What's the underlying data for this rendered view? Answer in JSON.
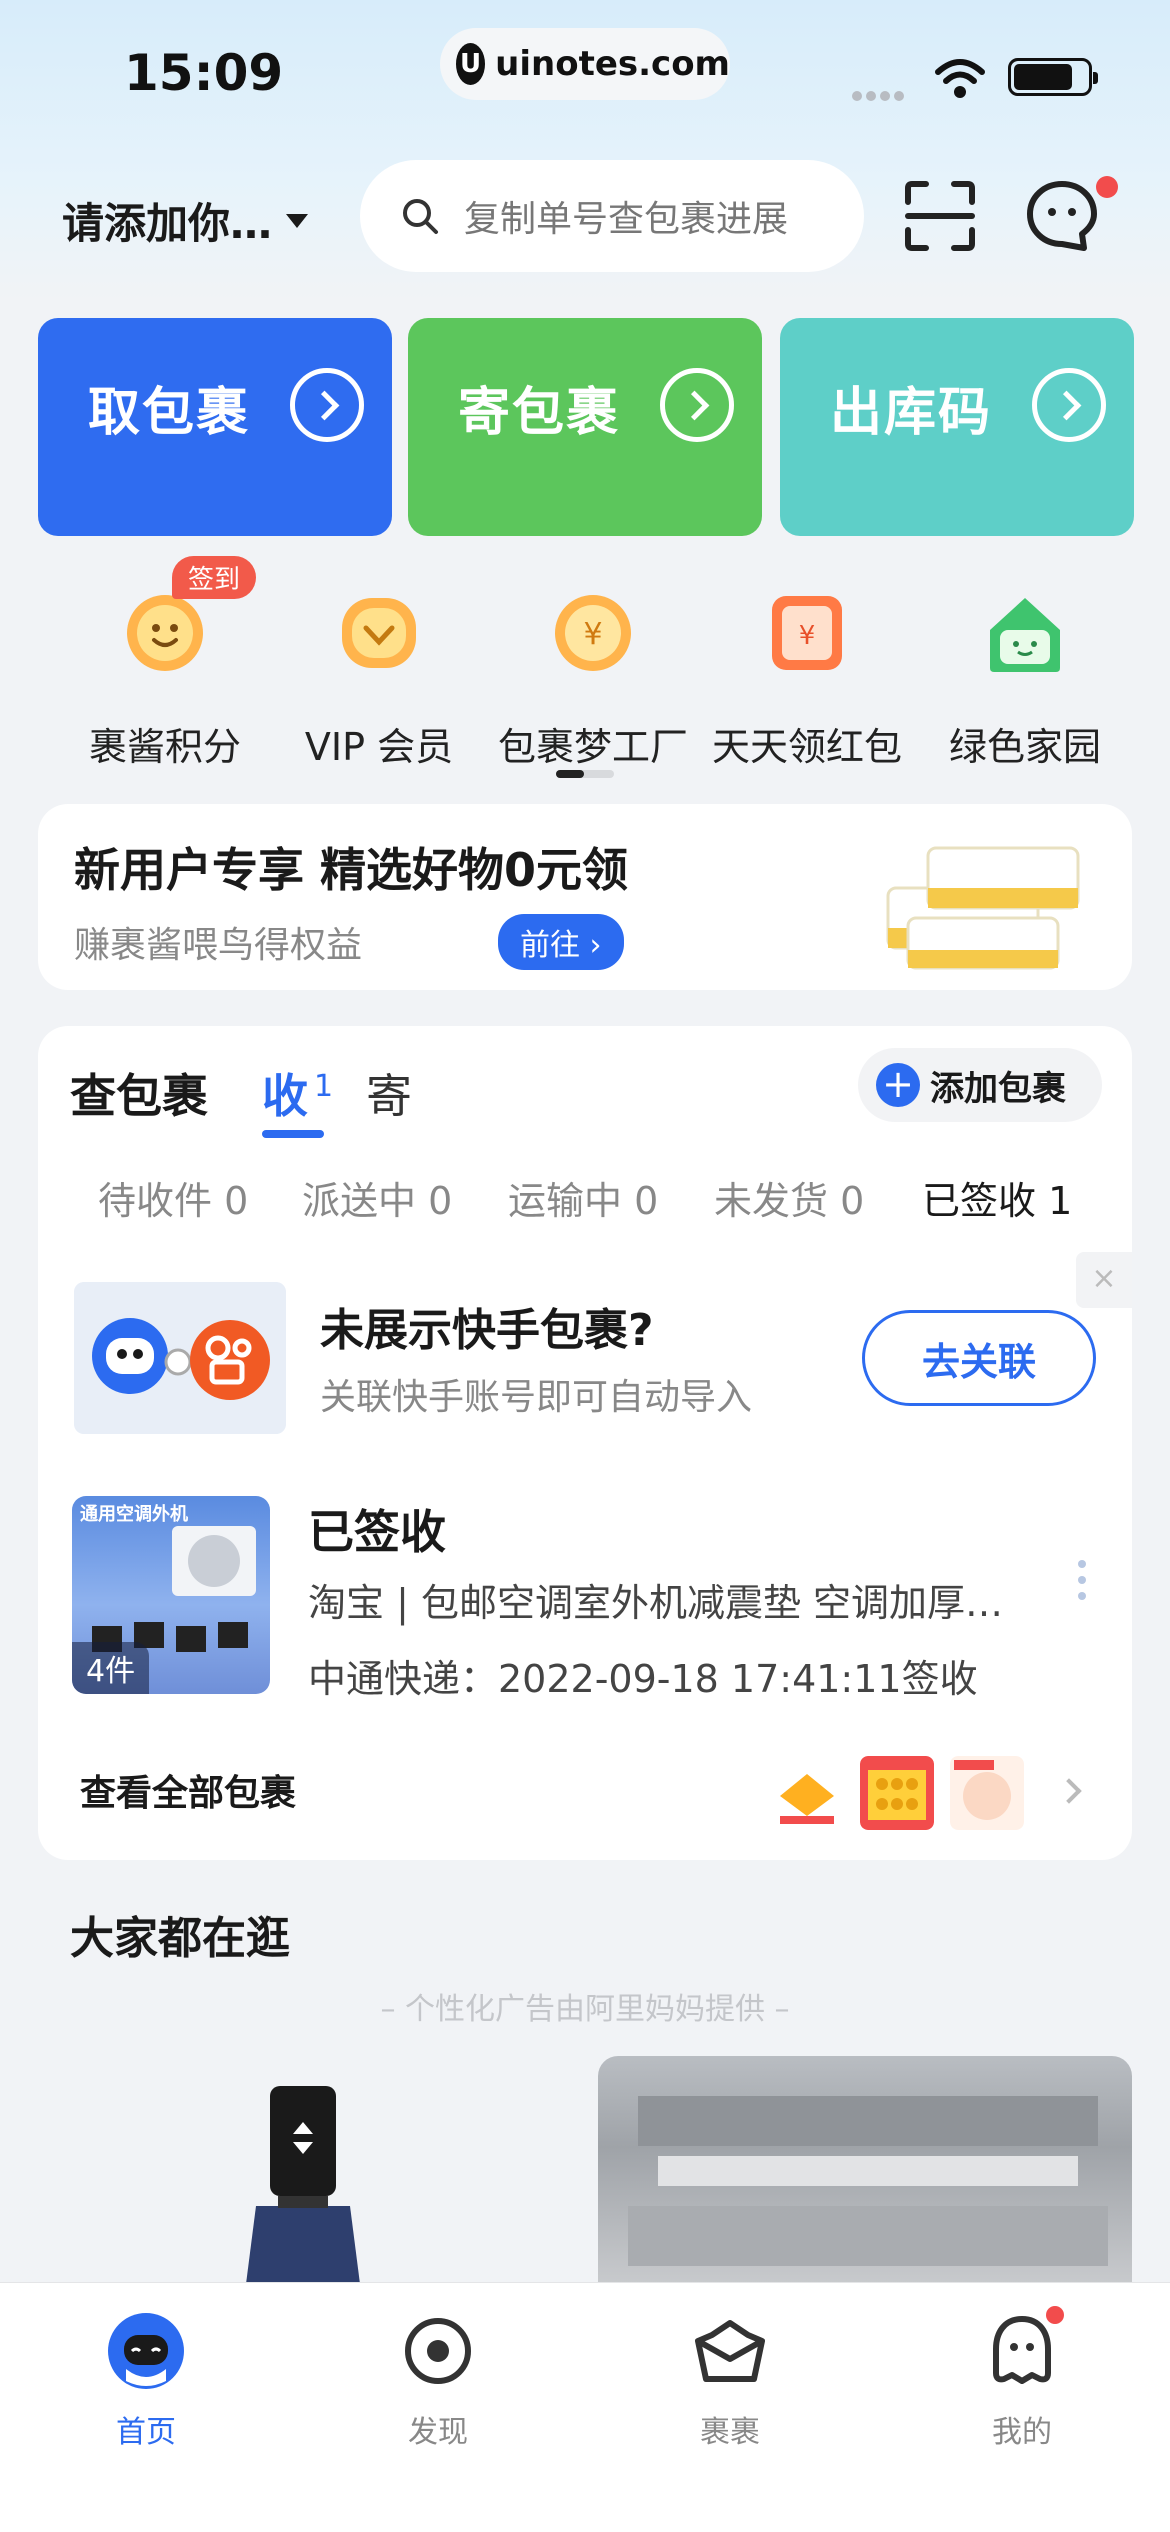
{
  "status_bar": {
    "time": "15:09",
    "url": "uinotes.com"
  },
  "top_bar": {
    "location": "请添加你…",
    "search_placeholder": "复制单号查包裹进展"
  },
  "quick_cards": [
    {
      "label": "取包裹",
      "color": "#2f6cf0"
    },
    {
      "label": "寄包裹",
      "color": "#5cc65c"
    },
    {
      "label": "出库码",
      "color": "#5ecfc8"
    }
  ],
  "services": {
    "badge": "签到",
    "items": [
      {
        "label": "裹酱积分",
        "icon": "smile-coin-icon"
      },
      {
        "label": "VIP 会员",
        "icon": "vip-heart-icon"
      },
      {
        "label": "包裹梦工厂",
        "icon": "yen-coin-icon"
      },
      {
        "label": "天天领红包",
        "icon": "red-envelope-icon"
      },
      {
        "label": "绿色家园",
        "icon": "green-house-icon"
      }
    ]
  },
  "promo": {
    "title": "新用户专享 精选好物0元领",
    "subtitle": "赚裹酱喂鸟得权益",
    "button": "前往"
  },
  "packages": {
    "title": "查包裹",
    "tab_receive": "收",
    "tab_receive_count": "1",
    "tab_send": "寄",
    "add_button": "添加包裹",
    "status_tabs": [
      "待收件 0",
      "派送中 0",
      "运输中 0",
      "未发货 0",
      "已签收 1"
    ],
    "link_banner": {
      "title": "未展示快手包裹?",
      "subtitle": "关联快手账号即可自动导入",
      "button": "去关联"
    },
    "item": {
      "thumb_text": "通用空调外机",
      "count": "4件",
      "status": "已签收",
      "title": "淘宝 | 包邮空调室外机减震垫 空调加厚…",
      "detail": "中通快递：2022-09-18 17:41:11签收"
    },
    "view_all": "查看全部包裹"
  },
  "feed": {
    "title": "大家都在逛",
    "subtitle": "– 个性化广告由阿里妈妈提供 –"
  },
  "tabbar": [
    {
      "label": "首页",
      "icon": "home-mascot-icon"
    },
    {
      "label": "发现",
      "icon": "discover-icon"
    },
    {
      "label": "裹裹",
      "icon": "crown-box-icon"
    },
    {
      "label": "我的",
      "icon": "profile-icon"
    }
  ]
}
